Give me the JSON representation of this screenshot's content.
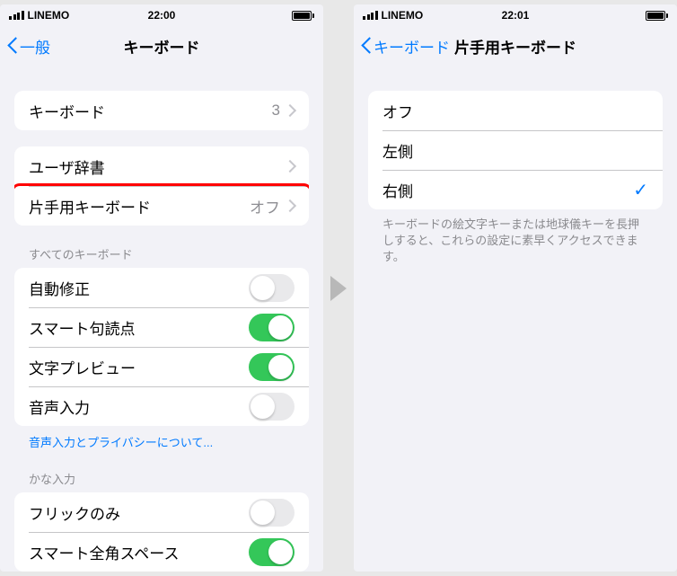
{
  "left": {
    "status": {
      "carrier": "LINEMO",
      "time": "22:00"
    },
    "nav": {
      "back": "一般",
      "title": "キーボード"
    },
    "groups": {
      "keyboards": {
        "label": "キーボード",
        "value": "3"
      },
      "user_dict": {
        "label": "ユーザ辞書"
      },
      "one_handed": {
        "label": "片手用キーボード",
        "value": "オフ"
      }
    },
    "sections": {
      "all_keyboards": {
        "header": "すべてのキーボード",
        "rows": {
          "autocorrect": {
            "label": "自動修正",
            "on": false
          },
          "smart_punct": {
            "label": "スマート句読点",
            "on": true
          },
          "char_preview": {
            "label": "文字プレビュー",
            "on": true
          },
          "dictation": {
            "label": "音声入力",
            "on": false
          }
        },
        "footer_link": "音声入力とプライバシーについて..."
      },
      "kana": {
        "header": "かな入力",
        "rows": {
          "flick_only": {
            "label": "フリックのみ",
            "on": false
          },
          "smart_fullwidth": {
            "label": "スマート全角スペース",
            "on": true
          }
        }
      }
    }
  },
  "right": {
    "status": {
      "carrier": "LINEMO",
      "time": "22:01"
    },
    "nav": {
      "back": "キーボード",
      "title": "片手用キーボード"
    },
    "options": {
      "off": {
        "label": "オフ",
        "selected": false
      },
      "left": {
        "label": "左側",
        "selected": false
      },
      "right": {
        "label": "右側",
        "selected": true
      }
    },
    "footer": "キーボードの絵文字キーまたは地球儀キーを長押しすると、これらの設定に素早くアクセスできます。"
  }
}
